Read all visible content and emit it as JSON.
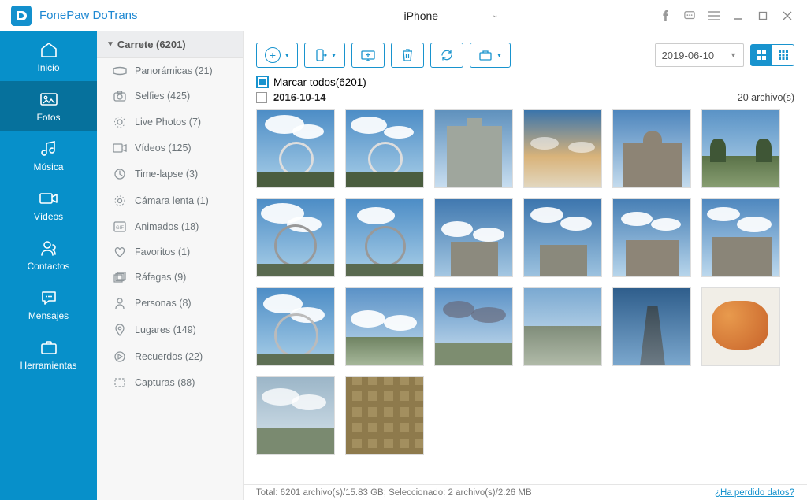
{
  "app": {
    "title": "FonePaw DoTrans"
  },
  "device": {
    "name": "iPhone"
  },
  "sidebar": [
    {
      "label": "Inicio"
    },
    {
      "label": "Fotos"
    },
    {
      "label": "Música"
    },
    {
      "label": "Vídeos"
    },
    {
      "label": "Contactos"
    },
    {
      "label": "Mensajes"
    },
    {
      "label": "Herramientas"
    }
  ],
  "albums": {
    "header": "Carrete (6201)",
    "items": [
      {
        "label": "Panorámicas (21)"
      },
      {
        "label": "Selfies (425)"
      },
      {
        "label": "Live Photos (7)"
      },
      {
        "label": "Vídeos (125)"
      },
      {
        "label": "Time-lapse (3)"
      },
      {
        "label": "Cámara lenta (1)"
      },
      {
        "label": "Animados (18)"
      },
      {
        "label": "Favoritos (1)"
      },
      {
        "label": "Ráfagas (9)"
      },
      {
        "label": "Personas (8)"
      },
      {
        "label": "Lugares (149)"
      },
      {
        "label": "Recuerdos (22)"
      },
      {
        "label": "Capturas (88)"
      }
    ]
  },
  "toolbar": {
    "date": "2019-06-10"
  },
  "selectAll": {
    "label": "Marcar todos(6201)"
  },
  "section": {
    "date": "2016-10-14",
    "count": "20 archivo(s)"
  },
  "status": {
    "text": "Total: 6201 archivo(s)/15.83 GB; Seleccionado: 2 archivo(s)/2.26 MB",
    "link": "¿Ha perdido datos?"
  }
}
